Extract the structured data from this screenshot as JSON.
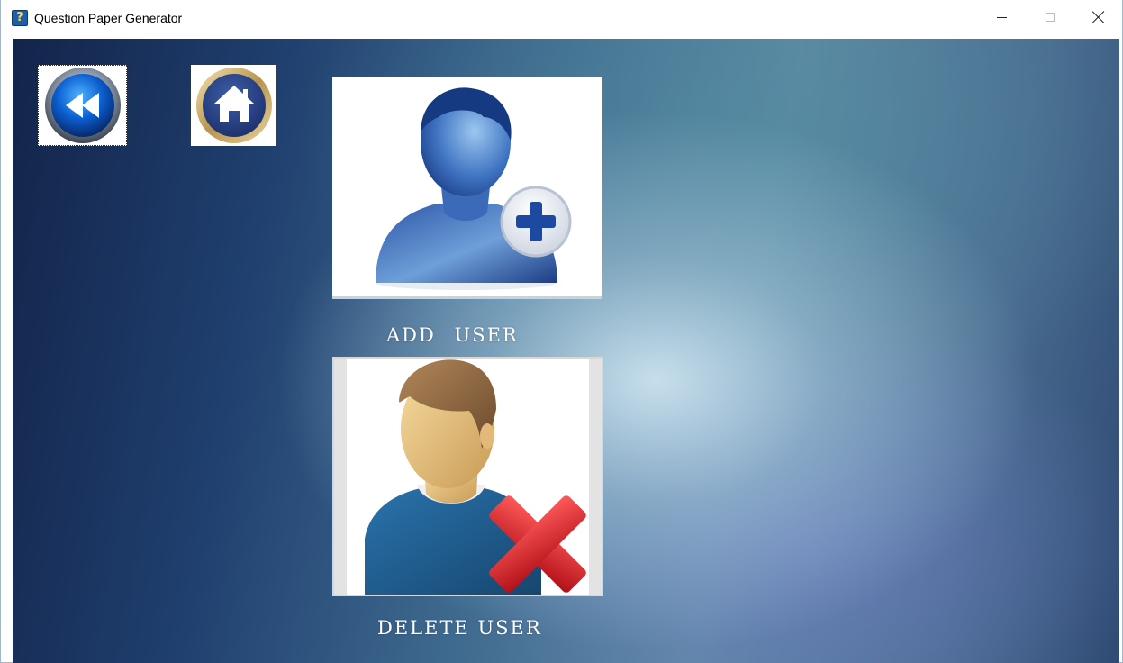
{
  "window": {
    "title": "Question Paper Generator",
    "app_icon_glyph": "?"
  },
  "nav": {
    "back_icon": "rewind-icon",
    "home_icon": "home-icon"
  },
  "actions": {
    "add_user_label": "ADD   USER",
    "delete_user_label": "DELETE USER"
  },
  "colors": {
    "accent_blue": "#1a4fa3",
    "delete_red": "#d8222a"
  }
}
